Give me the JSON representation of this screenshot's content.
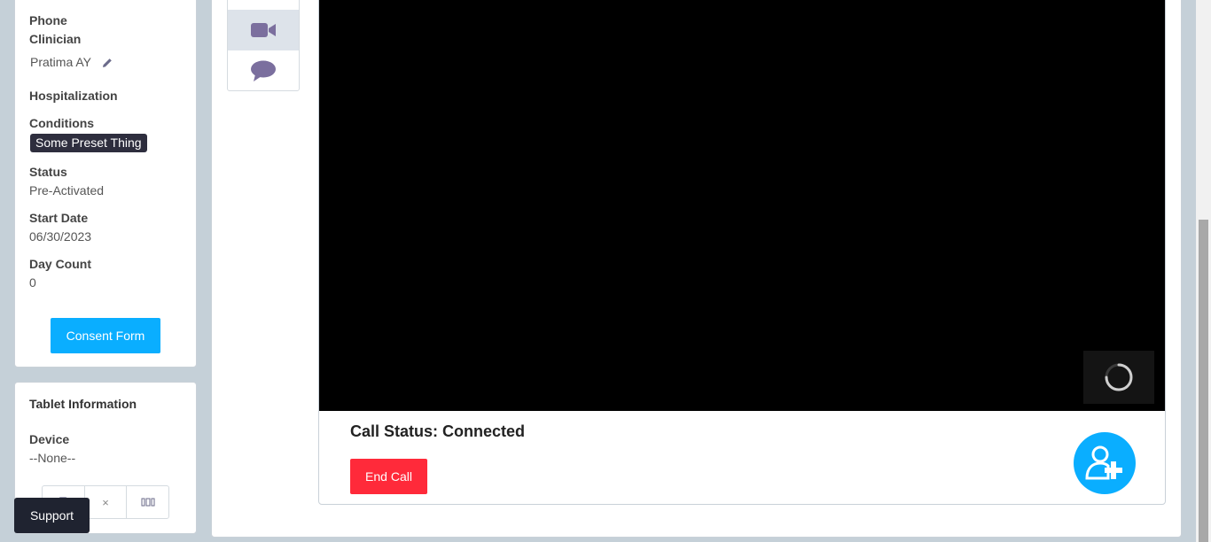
{
  "patient": {
    "phone_label": "Phone",
    "clinician_label": "Clinician",
    "clinician_name": "Pratima AY",
    "hospitalization_label": "Hospitalization",
    "conditions_label": "Conditions",
    "condition_tag": "Some Preset Thing",
    "status_label": "Status",
    "status_value": "Pre-Activated",
    "start_date_label": "Start Date",
    "start_date_value": "06/30/2023",
    "day_count_label": "Day Count",
    "day_count_value": "0",
    "consent_button": "Consent Form"
  },
  "tablet": {
    "title": "Tablet Information",
    "device_label": "Device",
    "device_value": "--None--",
    "remove_symbol": "×"
  },
  "support_button": "Support",
  "tabs": [
    {
      "icon": "phone-icon"
    },
    {
      "icon": "video-camera-icon",
      "active": true
    },
    {
      "icon": "chat-bubble-icon"
    }
  ],
  "call": {
    "status_text": "Call Status: Connected",
    "end_button": "End Call",
    "add_participant_icon": "add-user-icon"
  },
  "colors": {
    "accent": "#0aaeff",
    "danger": "#ff2a3a",
    "dark": "#1f2330",
    "icon_purple": "#7b6f9e"
  }
}
